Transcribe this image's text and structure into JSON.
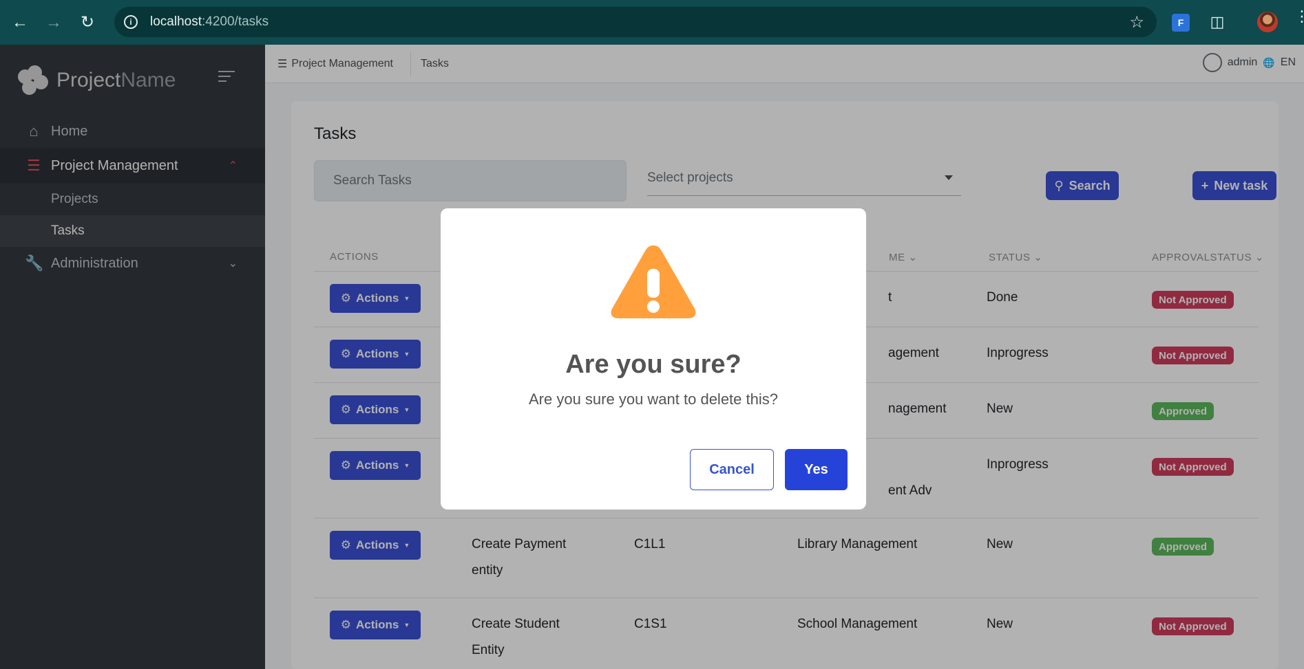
{
  "browser": {
    "url_host": "localhost",
    "url_path": ":4200/tasks",
    "extension_label": "F"
  },
  "sidebar": {
    "brand_main": "Project",
    "brand_light": "Name",
    "items": [
      {
        "label": "Home",
        "icon": "home-icon"
      },
      {
        "label": "Project Management",
        "icon": "list-check-icon",
        "expanded": true
      },
      {
        "label": "Administration",
        "icon": "wrench-icon"
      }
    ],
    "subitems": [
      {
        "label": "Projects"
      },
      {
        "label": "Tasks",
        "current": true
      }
    ]
  },
  "topbar": {
    "breadcrumb": [
      "Project Management",
      "Tasks"
    ],
    "user": "admin",
    "language": "EN"
  },
  "page": {
    "title": "Tasks",
    "search_placeholder": "Search Tasks",
    "select_placeholder": "Select projects",
    "search_button": "Search",
    "new_button": "New task"
  },
  "table": {
    "headers": [
      "ACTIONS",
      "ME",
      "STATUS",
      "APPROVALSTATUS"
    ],
    "action_label": "Actions",
    "rows": [
      {
        "task": "",
        "code": "",
        "project": "t",
        "status": "Done",
        "approval": "Not Approved"
      },
      {
        "task": "",
        "code": "",
        "project": "agement",
        "status": "Inprogress",
        "approval": "Not Approved"
      },
      {
        "task": "",
        "code": "",
        "project": "nagement",
        "status": "New",
        "approval": "Approved"
      },
      {
        "task": "",
        "code": "",
        "project": "ent Adv",
        "status": "Inprogress",
        "approval": "Not Approved"
      },
      {
        "task1": "Create Payment",
        "task2": "entity",
        "code": "C1L1",
        "project": "Library Management",
        "status": "New",
        "approval": "Approved"
      },
      {
        "task1": "Create Student",
        "task2": "Entity",
        "code": "C1S1",
        "project": "School Management",
        "status": "New",
        "approval": "Not Approved"
      }
    ]
  },
  "modal": {
    "icon": "warning-icon",
    "title": "Are you sure?",
    "text": "Are you sure you want to delete this?",
    "cancel": "Cancel",
    "confirm": "Yes"
  },
  "colors": {
    "primary": "#3c51d6",
    "danger_badge": "#d03d5d",
    "success_badge": "#5cb85c",
    "warning": "#ffa03c",
    "sidebar_bg": "#343a40"
  }
}
